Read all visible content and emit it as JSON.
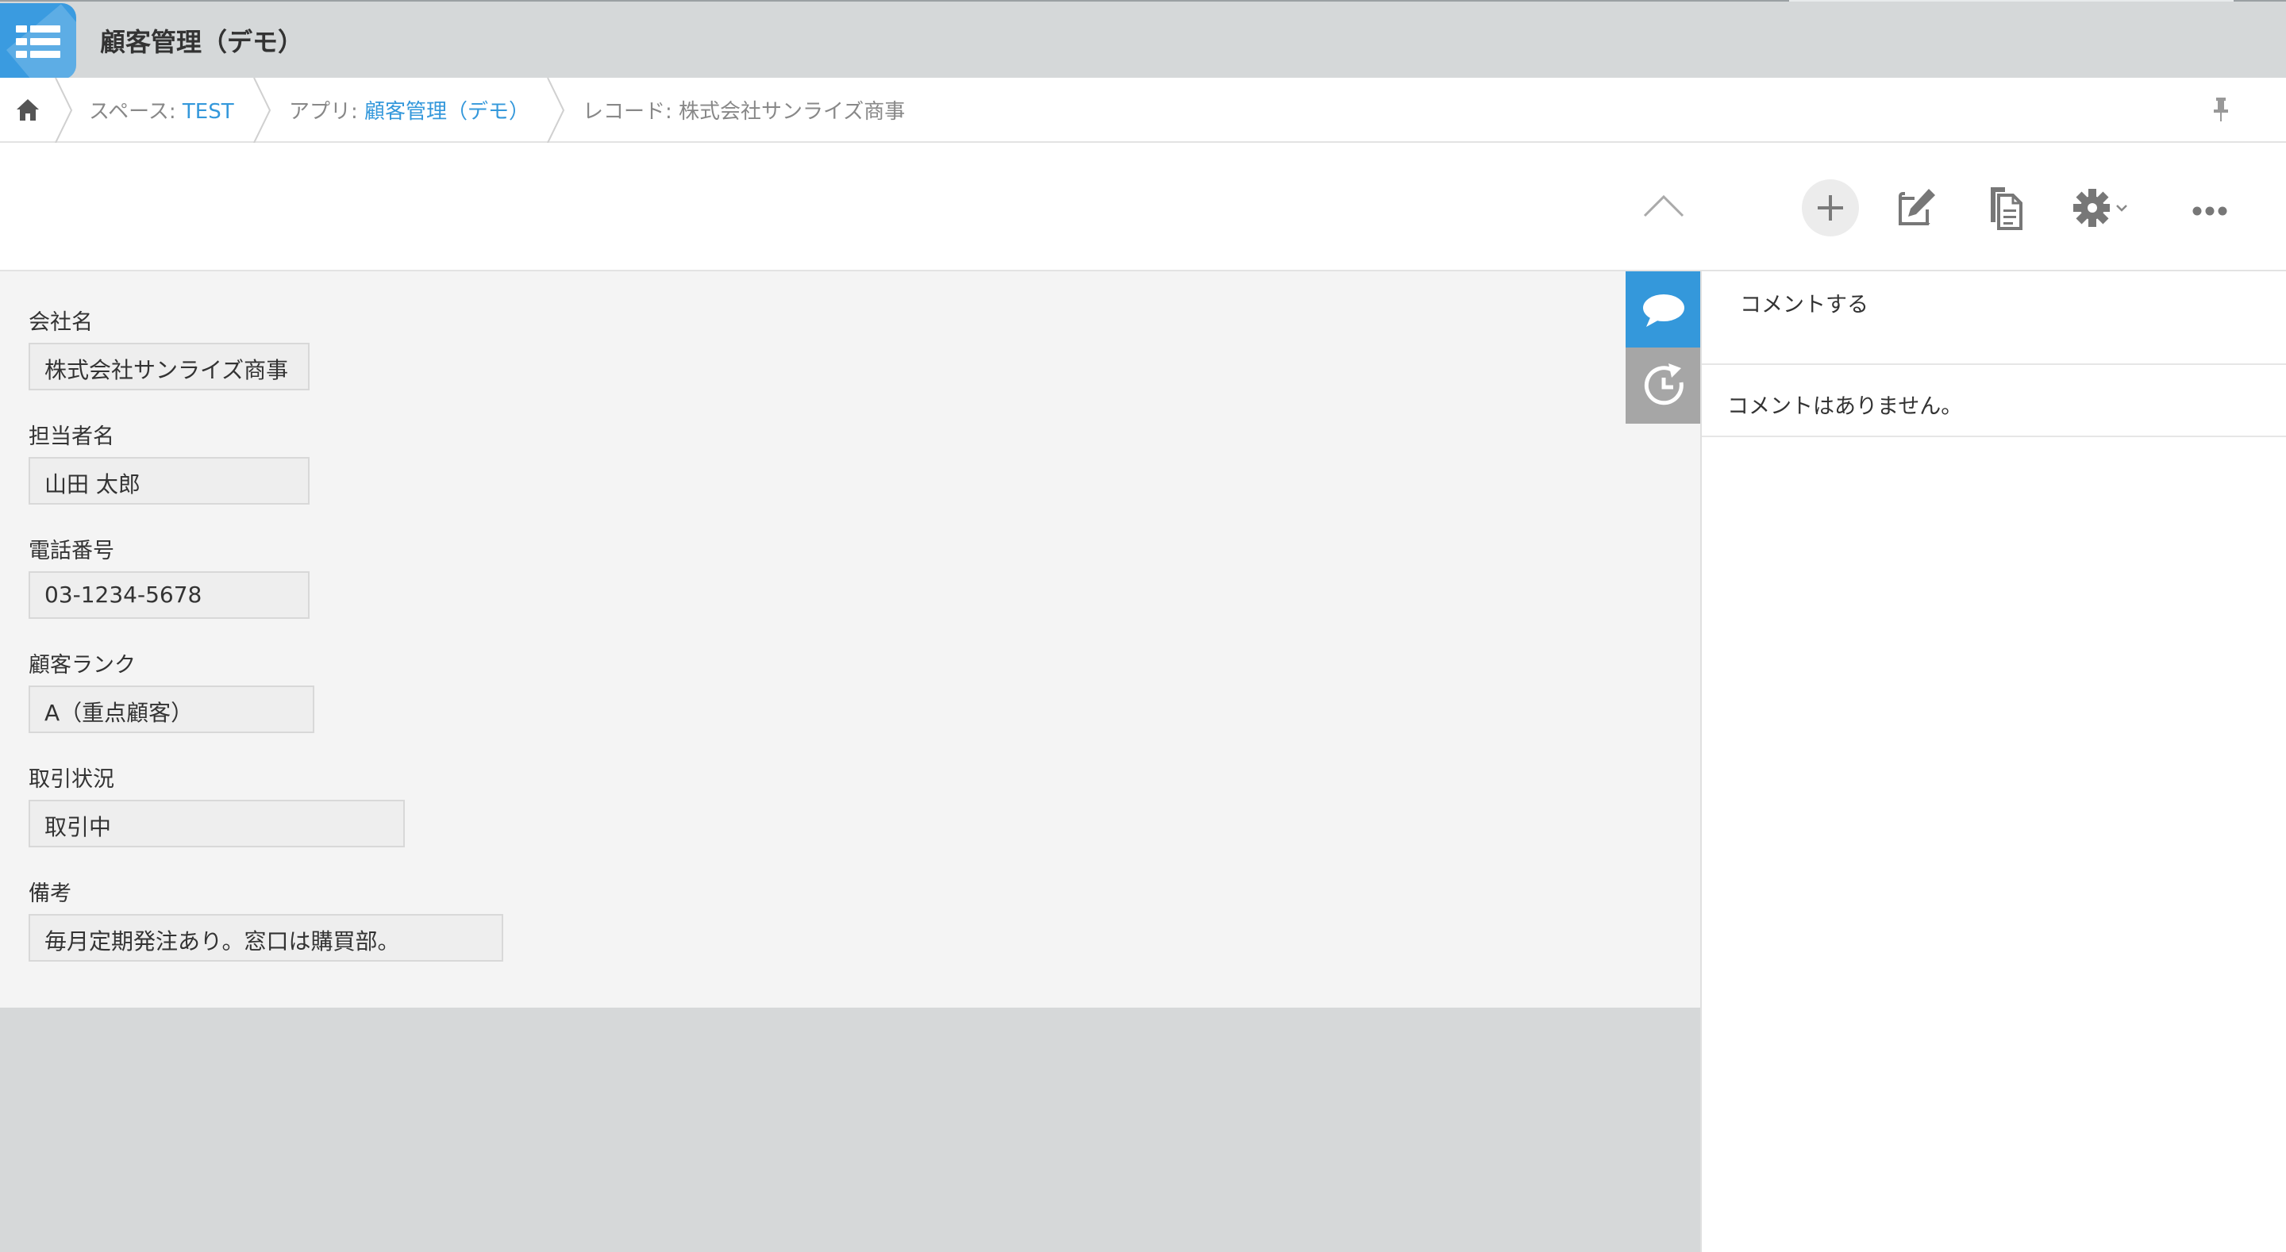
{
  "header": {
    "app_title": "顧客管理（デモ）",
    "icon": "app-list-icon"
  },
  "breadcrumb": {
    "home_icon": "home-icon",
    "space_prefix": "スペース: ",
    "space_name": "TEST",
    "app_prefix": "アプリ: ",
    "app_name": "顧客管理（デモ）",
    "record_label": "レコード: 株式会社サンライズ商事",
    "pin_icon": "pin-icon"
  },
  "toolbar": {
    "icons": [
      "chevron-up-icon",
      "add-icon",
      "edit-icon",
      "duplicate-icon",
      "gear-icon",
      "more-icon"
    ]
  },
  "record": {
    "fields": [
      {
        "label": "会社名",
        "value": "株式会社サンライズ商事"
      },
      {
        "label": "担当者名",
        "value": "山田 太郎"
      },
      {
        "label": "電話番号",
        "value": "03-1234-5678"
      },
      {
        "label": "顧客ランク",
        "value": "A（重点顧客）"
      },
      {
        "label": "取引状況",
        "value": "取引中"
      },
      {
        "label": "備考",
        "value": "毎月定期発注あり。窓口は購買部。"
      }
    ]
  },
  "side_tabs": {
    "comment_icon": "comment-icon",
    "history_icon": "history-icon"
  },
  "comments": {
    "input_placeholder": "コメントする",
    "empty_message": "コメントはありません。"
  },
  "colors": {
    "accent": "#3498db",
    "header_bg": "#d5d8d9",
    "record_bg": "#f4f4f4"
  }
}
